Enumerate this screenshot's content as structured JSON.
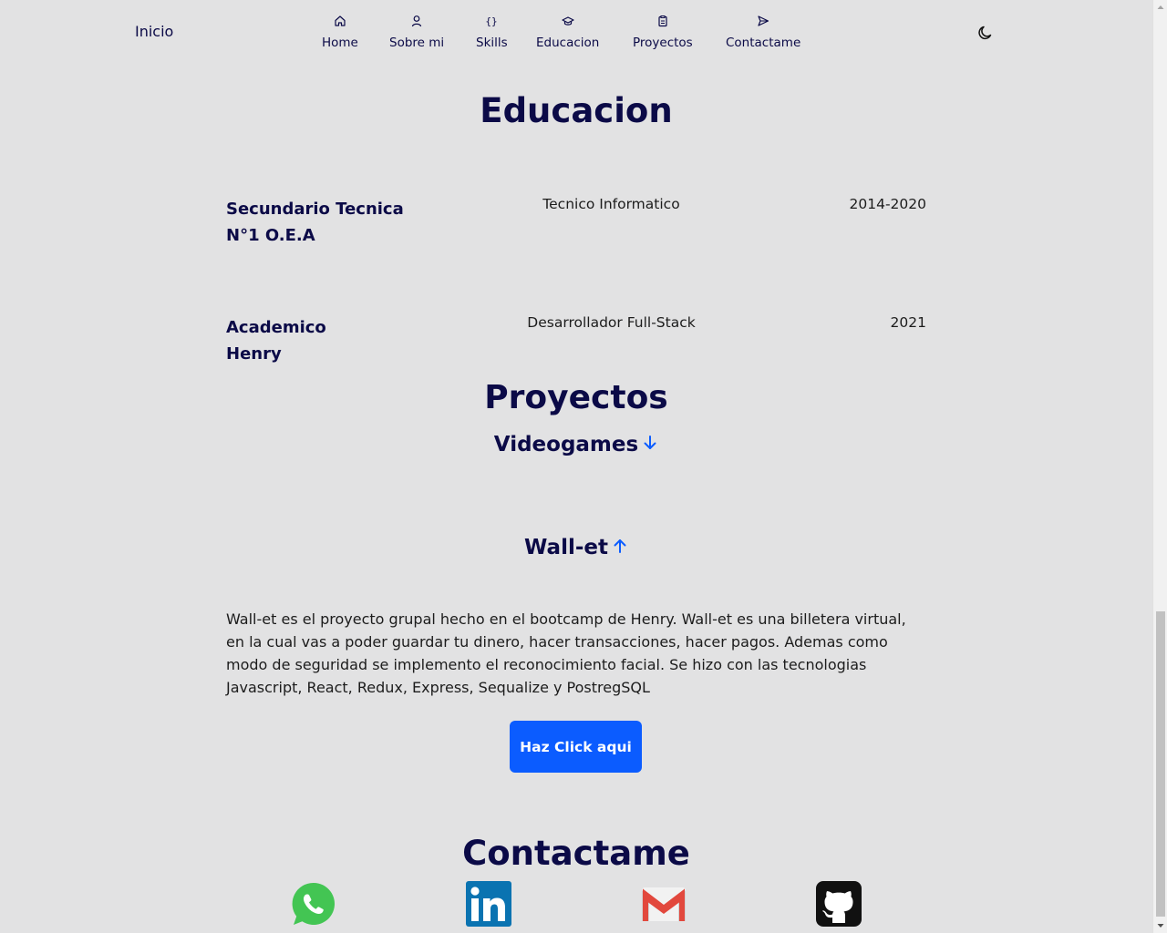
{
  "header": {
    "brand": "Inicio",
    "nav": [
      {
        "label": "Home",
        "icon": "home-icon"
      },
      {
        "label": "Sobre mi",
        "icon": "user-icon"
      },
      {
        "label": "Skills",
        "icon": "code-braces-icon"
      },
      {
        "label": "Educacion",
        "icon": "graduation-cap-icon"
      },
      {
        "label": "Proyectos",
        "icon": "clipboard-icon"
      },
      {
        "label": "Contactame",
        "icon": "send-icon"
      }
    ],
    "theme_icon": "moon-icon"
  },
  "education": {
    "title": "Educacion",
    "items": [
      {
        "institution": "Secundario Tecnica N°1 O.E.A",
        "degree": "Tecnico Informatico",
        "years": "2014-2020"
      },
      {
        "institution": "Academico Henry",
        "degree": "Desarrollador Full-Stack",
        "years": "2021"
      }
    ]
  },
  "projects": {
    "title": "Proyectos",
    "items": [
      {
        "name": "Videogames",
        "state_icon": "arrow-down-icon"
      },
      {
        "name": "Wall-et",
        "state_icon": "arrow-up-icon"
      }
    ],
    "description": "Wall-et es el proyecto grupal hecho en el bootcamp de Henry. Wall-et es una billetera virtual, en la cual vas a poder guardar tu dinero, hacer transacciones, hacer pagos. Ademas como modo de seguridad se implemento el reconocimiento facial. Se hizo con las tecnologias Javascript, React, Redux, Express, Sequalize y PostregSQL",
    "button": "Haz Click aqui"
  },
  "contact": {
    "title": "Contactame",
    "icons": [
      "whatsapp-icon",
      "linkedin-icon",
      "gmail-icon",
      "github-icon"
    ]
  },
  "colors": {
    "background": "#e2e2e3",
    "heading": "#0b0a47",
    "accent": "#0b5cff"
  }
}
